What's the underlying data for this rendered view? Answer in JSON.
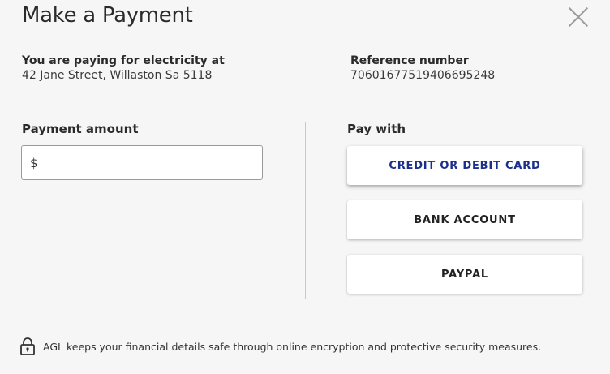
{
  "dialog": {
    "title": "Make a Payment",
    "close_icon": "close-icon"
  },
  "paying_for": {
    "label": "You are paying for electricity at",
    "address": "42 Jane Street, Willaston Sa 5118"
  },
  "reference": {
    "label": "Reference number",
    "value": "70601677519406695248"
  },
  "amount": {
    "label": "Payment amount",
    "prefix": "$",
    "value": ""
  },
  "pay_with": {
    "label": "Pay with",
    "options": [
      {
        "label": "CREDIT OR DEBIT CARD",
        "selected": true
      },
      {
        "label": "BANK ACCOUNT",
        "selected": false
      },
      {
        "label": "PAYPAL",
        "selected": false
      }
    ]
  },
  "footer": {
    "icon": "lock-icon",
    "text": "AGL keeps your financial details safe through online encryption and protective security measures."
  },
  "colors": {
    "background": "#f6f6f6",
    "selected_text": "#1c2f8c"
  }
}
